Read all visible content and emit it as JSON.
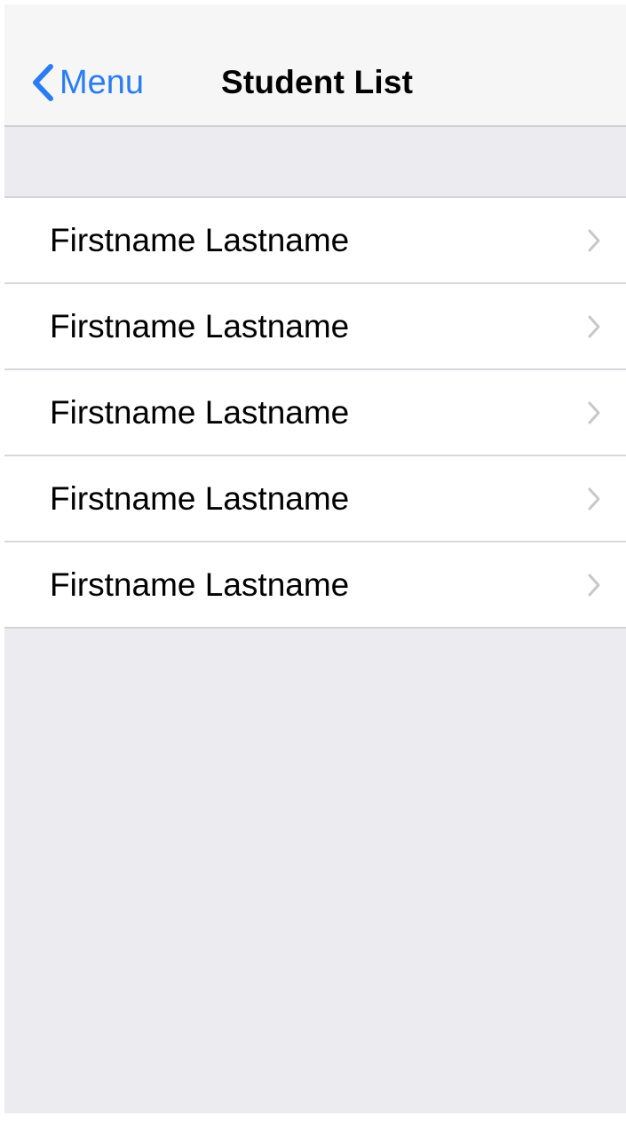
{
  "navbar": {
    "back_label": "Menu",
    "title": "Student List",
    "back_icon": "chevron-left-icon",
    "accent_color": "#2a7cf6"
  },
  "students": [
    {
      "name": "Firstname Lastname",
      "icon": "chevron-right-icon"
    },
    {
      "name": "Firstname Lastname",
      "icon": "chevron-right-icon"
    },
    {
      "name": "Firstname Lastname",
      "icon": "chevron-right-icon"
    },
    {
      "name": "Firstname Lastname",
      "icon": "chevron-right-icon"
    },
    {
      "name": "Firstname Lastname",
      "icon": "chevron-right-icon"
    }
  ],
  "colors": {
    "background": "#ebebf0",
    "navbar": "#f6f6f6",
    "cell": "#ffffff",
    "separator": "#d8d8dc",
    "disclosure": "#c7c7cc"
  }
}
